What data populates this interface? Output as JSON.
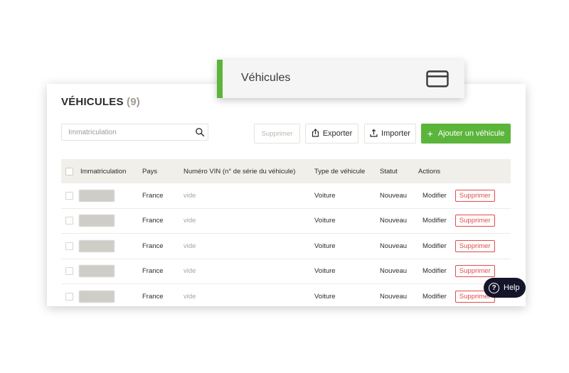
{
  "page": {
    "title": "VÉHICULES",
    "count": "(9)"
  },
  "banner": {
    "title": "Véhicules",
    "icon": "card-icon"
  },
  "search": {
    "placeholder": "Immatriculation",
    "icon": "search-icon"
  },
  "toolbar": {
    "delete_label": "Supprimer",
    "export_label": "Exporter",
    "import_label": "Importer",
    "add_label": "Ajouter un véhicule",
    "add_plus": "+"
  },
  "table": {
    "headers": [
      "Immatriculation",
      "Pays",
      "Numéro VIN (n° de série du véhicule)",
      "Type de véhicule",
      "Statut",
      "Actions"
    ],
    "rows": [
      {
        "pays": "France",
        "vin": "vide",
        "type": "Voiture",
        "statut": "Nouveau",
        "modify": "Modifier",
        "delete": "Supprimer"
      },
      {
        "pays": "France",
        "vin": "vide",
        "type": "Voiture",
        "statut": "Nouveau",
        "modify": "Modifier",
        "delete": "Supprimer"
      },
      {
        "pays": "France",
        "vin": "vide",
        "type": "Voiture",
        "statut": "Nouveau",
        "modify": "Modifier",
        "delete": "Supprimer"
      },
      {
        "pays": "France",
        "vin": "vide",
        "type": "Voiture",
        "statut": "Nouveau",
        "modify": "Modifier",
        "delete": "Supprimer"
      },
      {
        "pays": "France",
        "vin": "vide",
        "type": "Voiture",
        "statut": "Nouveau",
        "modify": "Modifier",
        "delete": "Supprimer"
      }
    ]
  },
  "help": {
    "label": "Help",
    "icon_glyph": "?"
  },
  "colors": {
    "accent_green": "#5bb53b",
    "danger_red": "#e34b4b",
    "help_bg": "#14142a"
  }
}
